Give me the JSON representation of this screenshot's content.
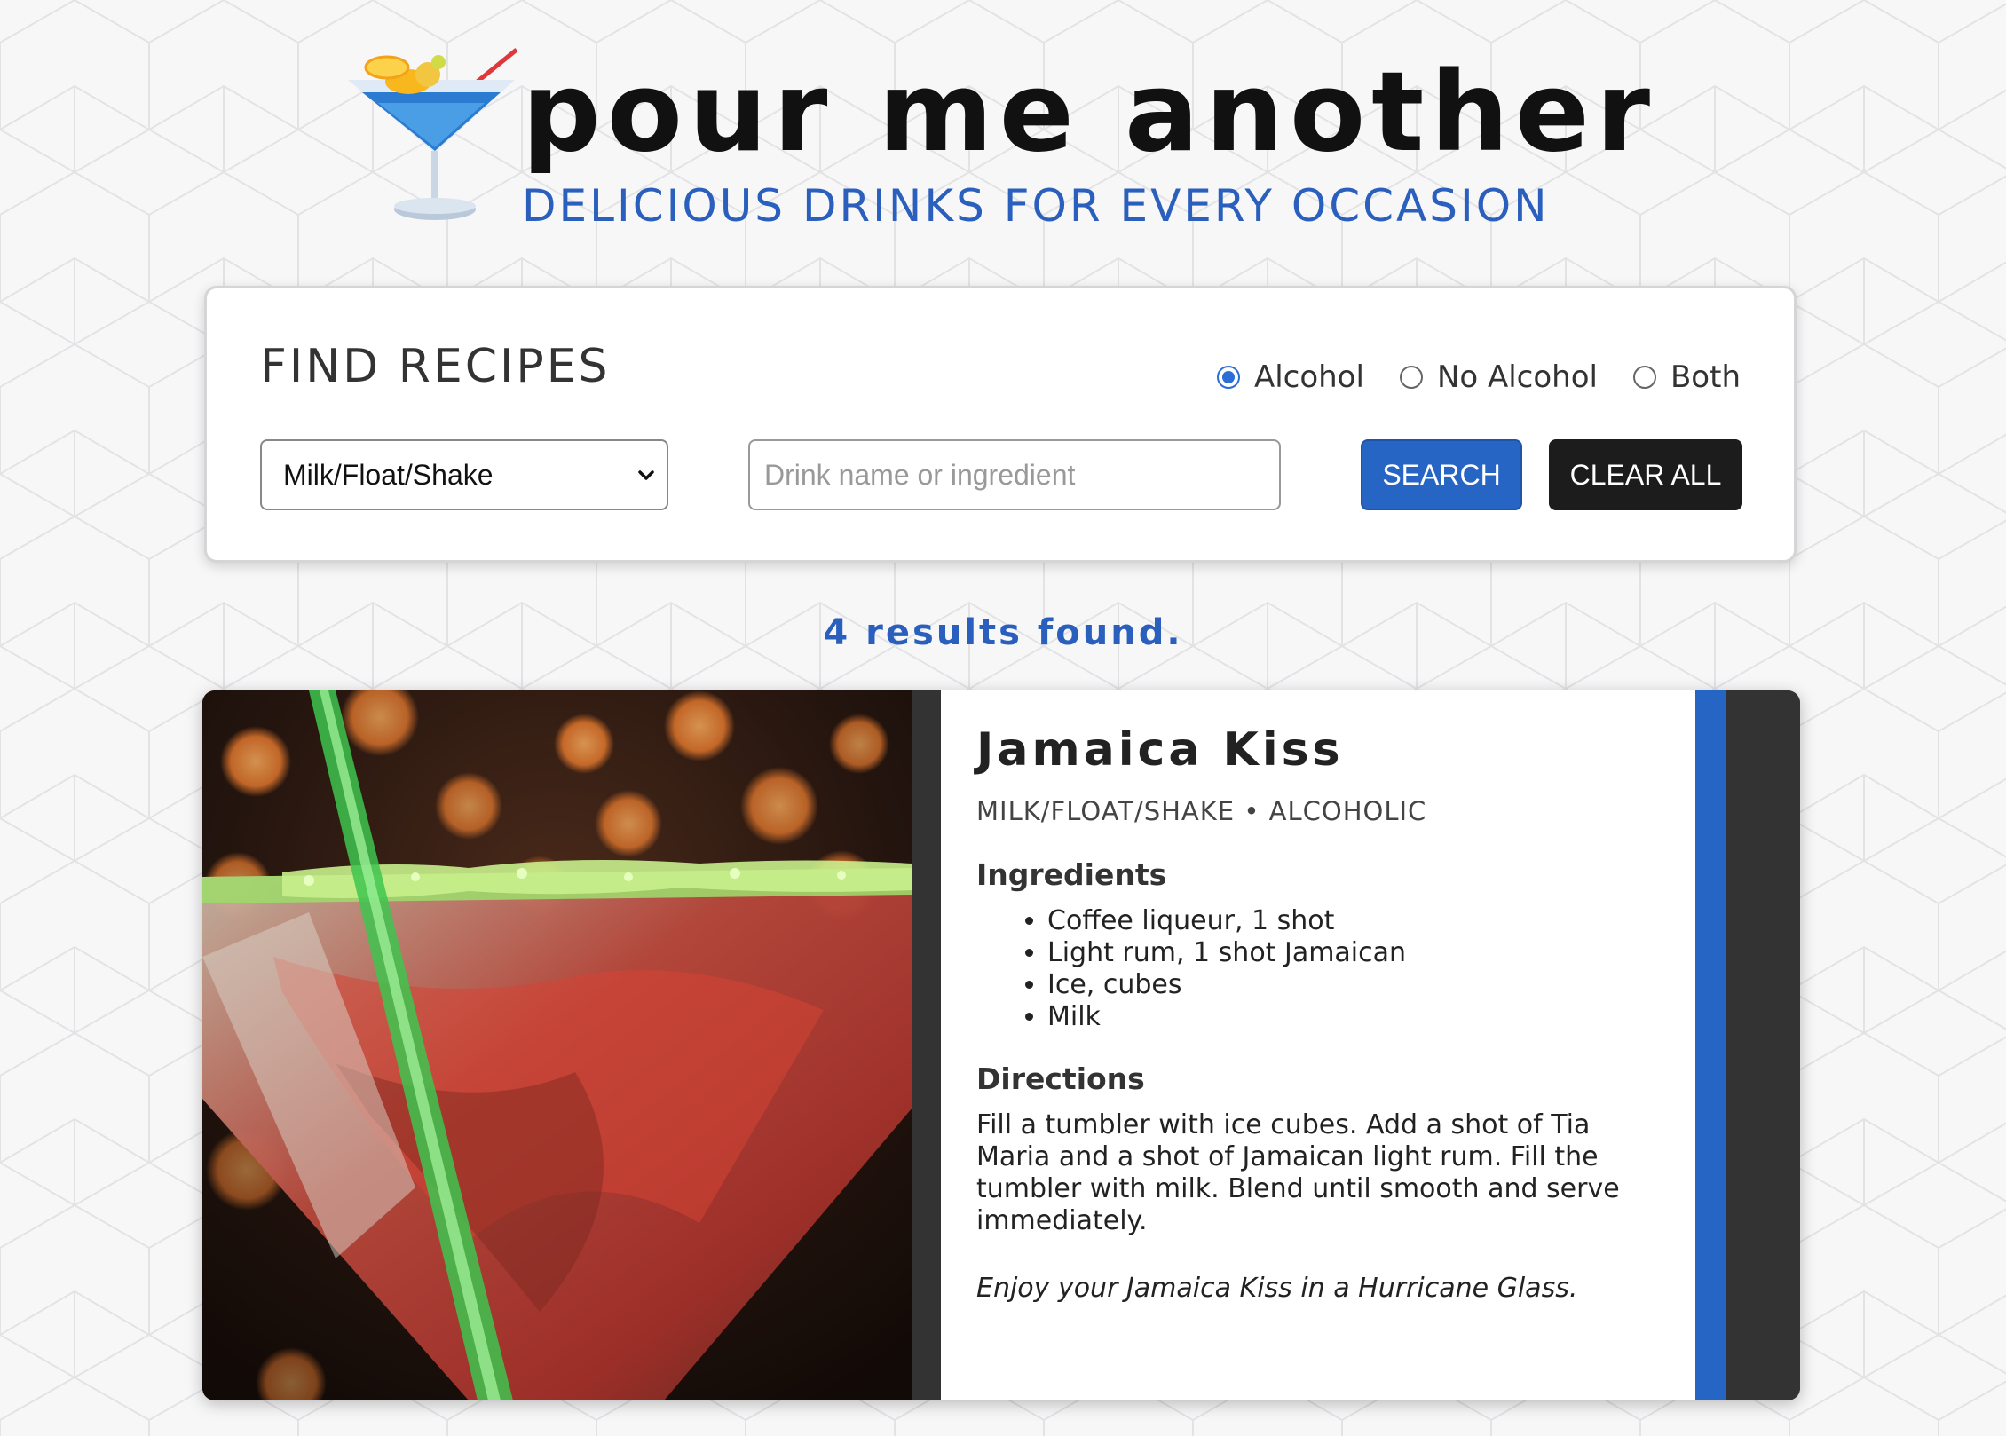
{
  "header": {
    "title": "pour me another",
    "tagline": "DELICIOUS DRINKS FOR EVERY OCCASION",
    "logo_icon": "cocktail-glass-icon"
  },
  "search": {
    "title": "FIND RECIPES",
    "category_selected": "Milk/Float/Shake",
    "input_placeholder": "Drink name or ingredient",
    "input_value": "",
    "search_label": "SEARCH",
    "clear_label": "CLEAR ALL",
    "options": [
      {
        "label": "Alcohol",
        "checked": true
      },
      {
        "label": "No Alcohol",
        "checked": false
      },
      {
        "label": "Both",
        "checked": false
      }
    ]
  },
  "results": {
    "count_text": "4 results found."
  },
  "recipe": {
    "name": "Jamaica Kiss",
    "meta": "MILK/FLOAT/SHAKE • ALCOHOLIC",
    "ingredients_heading": "Ingredients",
    "ingredients": [
      "Coffee liqueur, 1 shot",
      "Light rum, 1 shot Jamaican",
      "Ice, cubes",
      "Milk"
    ],
    "directions_heading": "Directions",
    "directions": "Fill a tumbler with ice cubes. Add a shot of Tia Maria and a shot of Jamaican light rum. Fill the tumbler with milk. Blend until smooth and serve immediately.",
    "enjoy": "Enjoy your Jamaica Kiss in a Hurricane Glass."
  },
  "colors": {
    "accent_blue": "#2765c4",
    "dark": "#1c1c1c",
    "card_side": "#333333"
  }
}
